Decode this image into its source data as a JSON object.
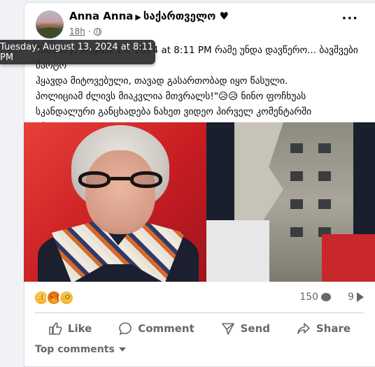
{
  "post": {
    "author": "Anna Anna",
    "shared_to": "საქართველო ♥",
    "time": "18h",
    "privacy_icon": "globe-icon",
    "text_line1": "Tuesday, August 13, 2024 at 8:11 PM რამე უნდა დავწერო... ბავშვები მარტო",
    "text_line2": "ჰყავდა მიტოვებული, თავად გასართობად იყო წასული.",
    "text_line3": "პოლიციამ ძლივს მიაკვლია მთვრალს!\"😥😥 ნინო ფოჩხუას",
    "text_line4": "სკანდალური განცხადება ნახეთ ვიდეო პირველ კომენტარში",
    "text_line5": "📌"
  },
  "tooltip": {
    "text": "Tuesday, August 13, 2024 at 8:11 PM"
  },
  "stats": {
    "comments": "150",
    "shares": "9",
    "reactions": [
      "sad",
      "angry",
      "wow"
    ]
  },
  "actions": {
    "like": "Like",
    "comment": "Comment",
    "send": "Send",
    "share": "Share"
  },
  "comments": {
    "sort_label": "Top comments"
  }
}
